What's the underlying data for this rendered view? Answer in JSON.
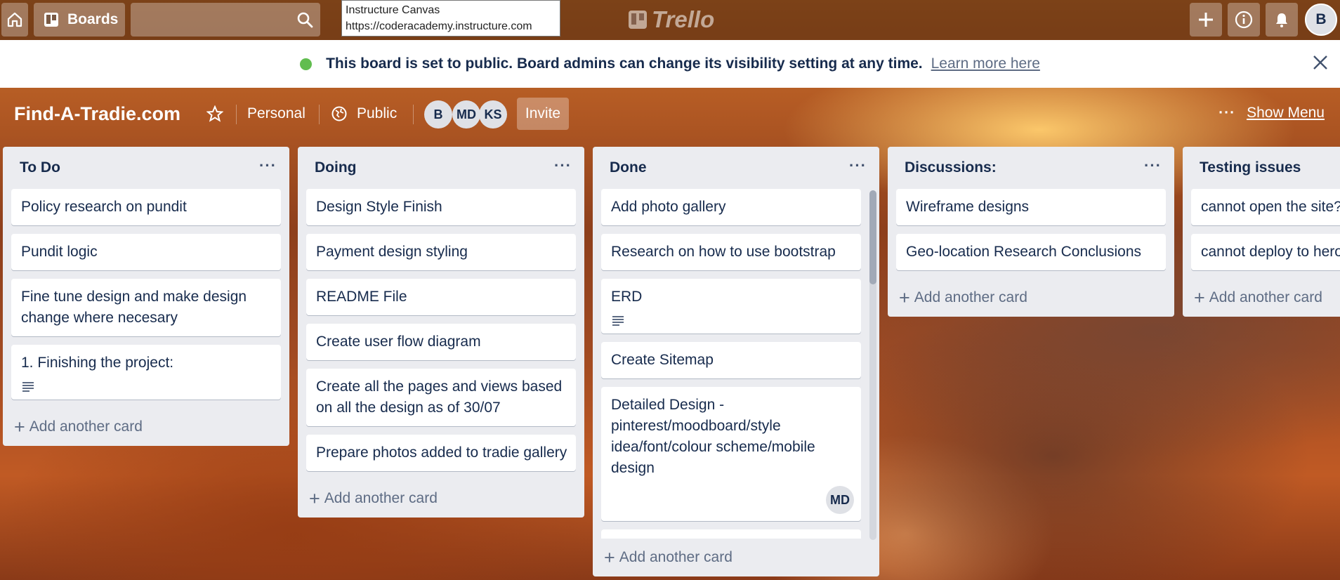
{
  "nav": {
    "boards_label": "Boards",
    "tooltip_title": "Instructure Canvas",
    "tooltip_url": "https://coderacademy.instructure.com",
    "logo_text": "Trello",
    "user_initial": "B"
  },
  "banner": {
    "message": "This board is set to public. Board admins can change its visibility setting at any time.",
    "link": "Learn more here"
  },
  "board": {
    "title": "Find-A-Tradie.com",
    "team": "Personal",
    "visibility": "Public",
    "members": [
      "B",
      "MD",
      "KS"
    ],
    "invite": "Invite",
    "show_menu": "Show Menu"
  },
  "lists": [
    {
      "title": "To Do",
      "cards": [
        {
          "text": "Policy research on pundit"
        },
        {
          "text": "Pundit logic"
        },
        {
          "text": "Fine tune design and make design change where necesary"
        },
        {
          "text": "1. Finishing the project:",
          "has_description": true
        }
      ],
      "add_label": "Add another card"
    },
    {
      "title": "Doing",
      "cards": [
        {
          "text": "Design Style Finish"
        },
        {
          "text": "Payment design styling"
        },
        {
          "text": "README File"
        },
        {
          "text": "Create user flow diagram"
        },
        {
          "text": "Create all the pages and views based on all the design as of 30/07"
        },
        {
          "text": "Prepare photos added to tradie gallery"
        }
      ],
      "add_label": "Add another card"
    },
    {
      "title": "Done",
      "cards": [
        {
          "text": "Add photo gallery"
        },
        {
          "text": "Research on how to use bootstrap"
        },
        {
          "text": "ERD",
          "has_description": true
        },
        {
          "text": "Create Sitemap"
        },
        {
          "text": "Detailed Design - pinterest/moodboard/style idea/font/colour scheme/mobile design",
          "member": "MD"
        }
      ],
      "add_label": "Add another card"
    },
    {
      "title": "Discussions:",
      "cards": [
        {
          "text": "Wireframe designs"
        },
        {
          "text": "Geo-location Research Conclusions"
        }
      ],
      "add_label": "Add another card"
    },
    {
      "title": "Testing issues",
      "cards": [
        {
          "text": "cannot open the site?"
        },
        {
          "text": "cannot deploy to hero"
        }
      ],
      "add_label": "Add another card"
    }
  ],
  "colors": {
    "list_bg": "#ebecf0",
    "card_text": "#172b4d",
    "public_green": "#61bd4f"
  }
}
